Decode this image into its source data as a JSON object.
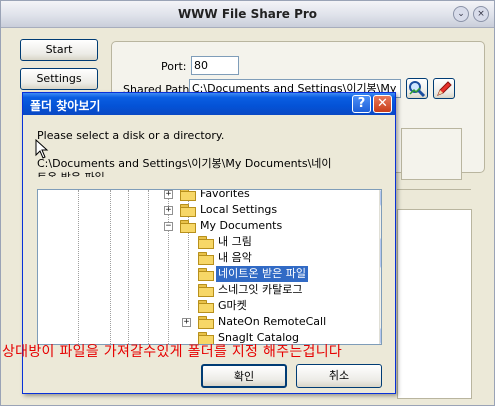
{
  "app": {
    "title": "WWW File Share Pro",
    "start_label": "Start",
    "settings_label": "Settings",
    "port_label": "Port:",
    "port_value": "80",
    "shared_path_label": "Shared Path:",
    "shared_path_value": "C:\\Documents and Settings\\이기봉\\My Do"
  },
  "dialog": {
    "title": "폴더 찾아보기",
    "help_label": "?",
    "close_label": "✕",
    "prompt": "Please select a disk or a directory.",
    "path_line1": "C:\\Documents and Settings\\이기봉\\My Documents\\네이",
    "path_line2": "트온 받은 파일",
    "ok_label": "확인",
    "cancel_label": "취소",
    "tree": [
      {
        "label": "Favorites",
        "expander": "+",
        "level": 0,
        "selected": false
      },
      {
        "label": "Local Settings",
        "expander": "+",
        "level": 0,
        "selected": false
      },
      {
        "label": "My Documents",
        "expander": "−",
        "level": 0,
        "selected": false
      },
      {
        "label": "내 그림",
        "expander": "",
        "level": 1,
        "selected": false
      },
      {
        "label": "내 음악",
        "expander": "",
        "level": 1,
        "selected": false
      },
      {
        "label": "네이트온 받은 파일",
        "expander": "",
        "level": 1,
        "selected": true
      },
      {
        "label": "스네그잇 카탈로그",
        "expander": "",
        "level": 1,
        "selected": false
      },
      {
        "label": "G마켓",
        "expander": "",
        "level": 1,
        "selected": false
      },
      {
        "label": "NateOn RemoteCall",
        "expander": "+",
        "level": 1,
        "selected": false
      },
      {
        "label": "SnagIt Catalog",
        "expander": "",
        "level": 1,
        "selected": false
      }
    ]
  },
  "annotation": {
    "text": "상대방이 파일을 가져갈수있게 폴더를 지정 해주는겁니다",
    "color": "#e60000"
  }
}
